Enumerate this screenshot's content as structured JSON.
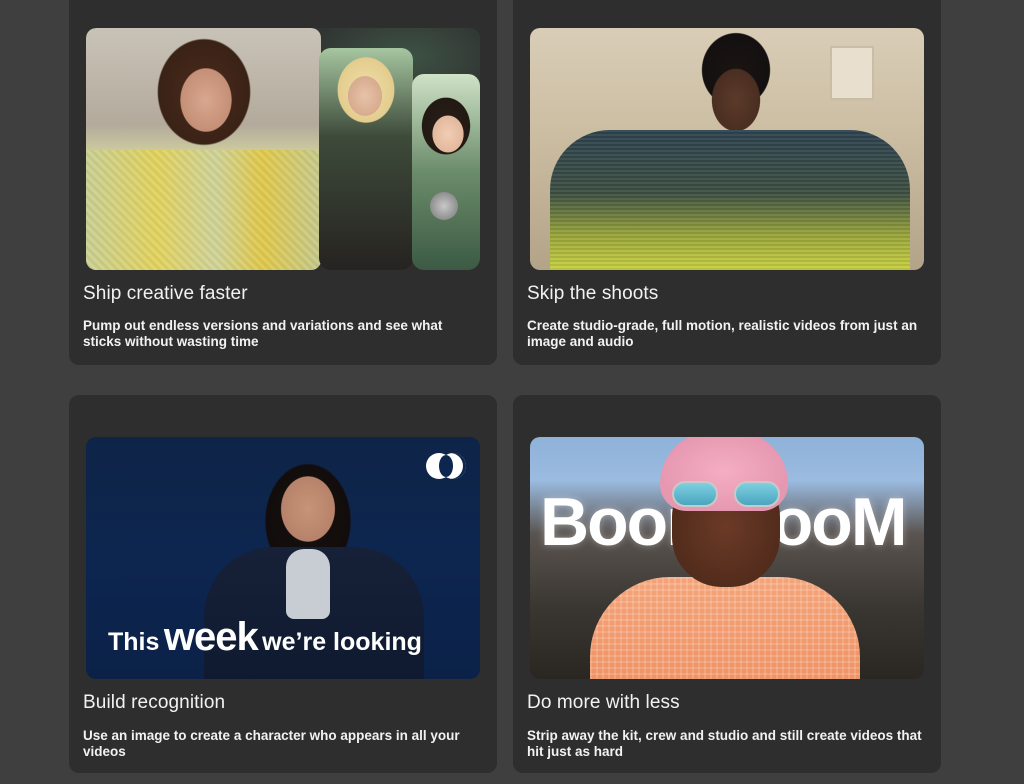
{
  "cards": [
    {
      "title": "Ship creative faster",
      "description": "Pump out endless versions and variations and see what sticks without wasting time"
    },
    {
      "title": "Skip the shoots",
      "description": "Create studio-grade, full motion, realistic videos from just an image and audio"
    },
    {
      "title": "Build recognition",
      "description": "Use an image to create a character who appears in all your videos",
      "overlay_small_1": "This",
      "overlay_big": "week",
      "overlay_small_2": "we’re looking",
      "logo_icon": "two-overlapping-circles-logo"
    },
    {
      "title": "Do more with less",
      "description": "Strip away the kit, crew and studio and still create videos that hit just as hard",
      "overlay_text": "BoomBooM"
    }
  ],
  "colors": {
    "page_background": "#3f3f3f",
    "card_background": "#2e2e2e",
    "text": "#f2f2f2"
  }
}
